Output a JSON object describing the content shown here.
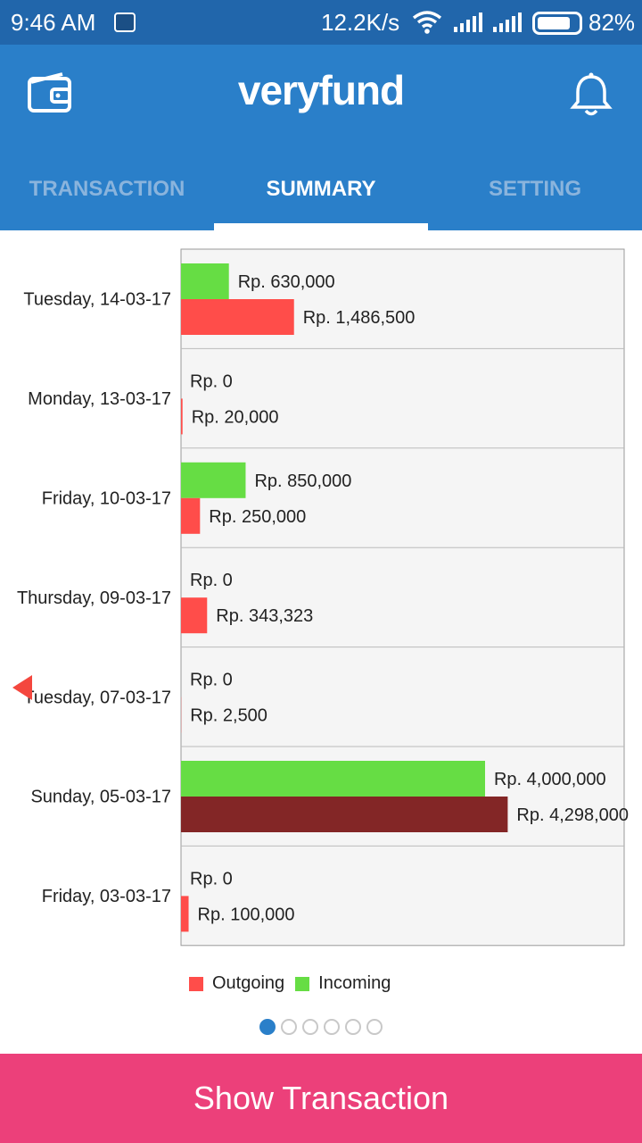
{
  "status_bar": {
    "time": "9:46 AM",
    "speed": "12.2K/s",
    "battery": "82%",
    "battery_level": 0.82
  },
  "header": {
    "logo": "veryfund",
    "icons": [
      "wallet-icon",
      "bell-icon"
    ]
  },
  "tabs": [
    {
      "label": "TRANSACTION",
      "active": false
    },
    {
      "label": "SUMMARY",
      "active": true
    },
    {
      "label": "SETTING",
      "active": false
    }
  ],
  "chart_data": {
    "type": "bar",
    "orientation": "horizontal",
    "categories": [
      "Tuesday, 14-03-17",
      "Monday, 13-03-17",
      "Friday, 10-03-17",
      "Thursday, 09-03-17",
      "Tuesday, 07-03-17",
      "Sunday, 05-03-17",
      "Friday, 03-03-17"
    ],
    "series": [
      {
        "name": "Incoming",
        "color": "#66dd44",
        "values": [
          630000,
          0,
          850000,
          0,
          0,
          4000000,
          0
        ],
        "labels": [
          "Rp. 630,000",
          "Rp. 0",
          "Rp. 850,000",
          "Rp. 0",
          "Rp. 0",
          "Rp. 4,000,000",
          "Rp. 0"
        ]
      },
      {
        "name": "Outgoing",
        "color": "#ff4d4a",
        "values": [
          1486500,
          20000,
          250000,
          343323,
          2500,
          4298000,
          100000
        ],
        "labels": [
          "Rp. 1,486,500",
          "Rp. 20,000",
          "Rp. 250,000",
          "Rp. 343,323",
          "Rp. 2,500",
          "Rp. 4,298,000",
          "Rp. 100,000"
        ]
      }
    ],
    "highlight": {
      "category_index": 5,
      "series": "Outgoing",
      "color": "#832626"
    },
    "xlim": [
      0,
      5830000
    ],
    "legend": {
      "position": "bottom",
      "entries": [
        {
          "name": "Outgoing",
          "color": "#ff4d4a"
        },
        {
          "name": "Incoming",
          "color": "#66dd44"
        }
      ]
    }
  },
  "pager": {
    "count": 6,
    "active": 0
  },
  "bottom_button": {
    "label": "Show Transaction"
  }
}
